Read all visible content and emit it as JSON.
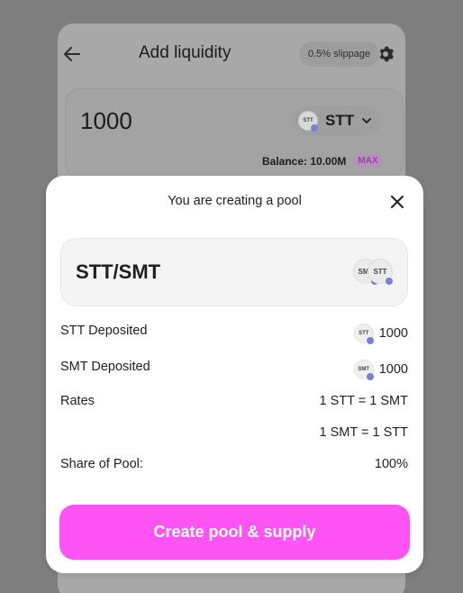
{
  "background": {
    "title": "Add liquidity",
    "slippage": "0.5% slippage",
    "input": {
      "amount": "1000",
      "token": "STT",
      "token_icon_text": "STT",
      "balance": "Balance: 10.00M",
      "max_label": "MAX"
    }
  },
  "modal": {
    "title": "You are creating a pool",
    "pair": "STT/SMT",
    "pair_icon_a": "SMT",
    "pair_icon_b": "STT",
    "rows": [
      {
        "label": "STT Deposited",
        "value": "1000",
        "icon_text": "STT"
      },
      {
        "label": "SMT Deposited",
        "value": "1000",
        "icon_text": "SMT"
      },
      {
        "label": "Rates",
        "value": "1 STT = 1 SMT"
      },
      {
        "label": "",
        "value": "1 SMT = 1 STT"
      },
      {
        "label": "Share of Pool:",
        "value": "100%"
      }
    ],
    "cta_label": "Create pool & supply"
  },
  "colors": {
    "accent": "#ff54f3",
    "overlay": "#7e7e7e",
    "token_arrow": "#7b7fd6"
  },
  "icons": [
    "back-arrow-icon",
    "gear-icon",
    "chevron-down-icon",
    "close-icon",
    "token-icon"
  ]
}
